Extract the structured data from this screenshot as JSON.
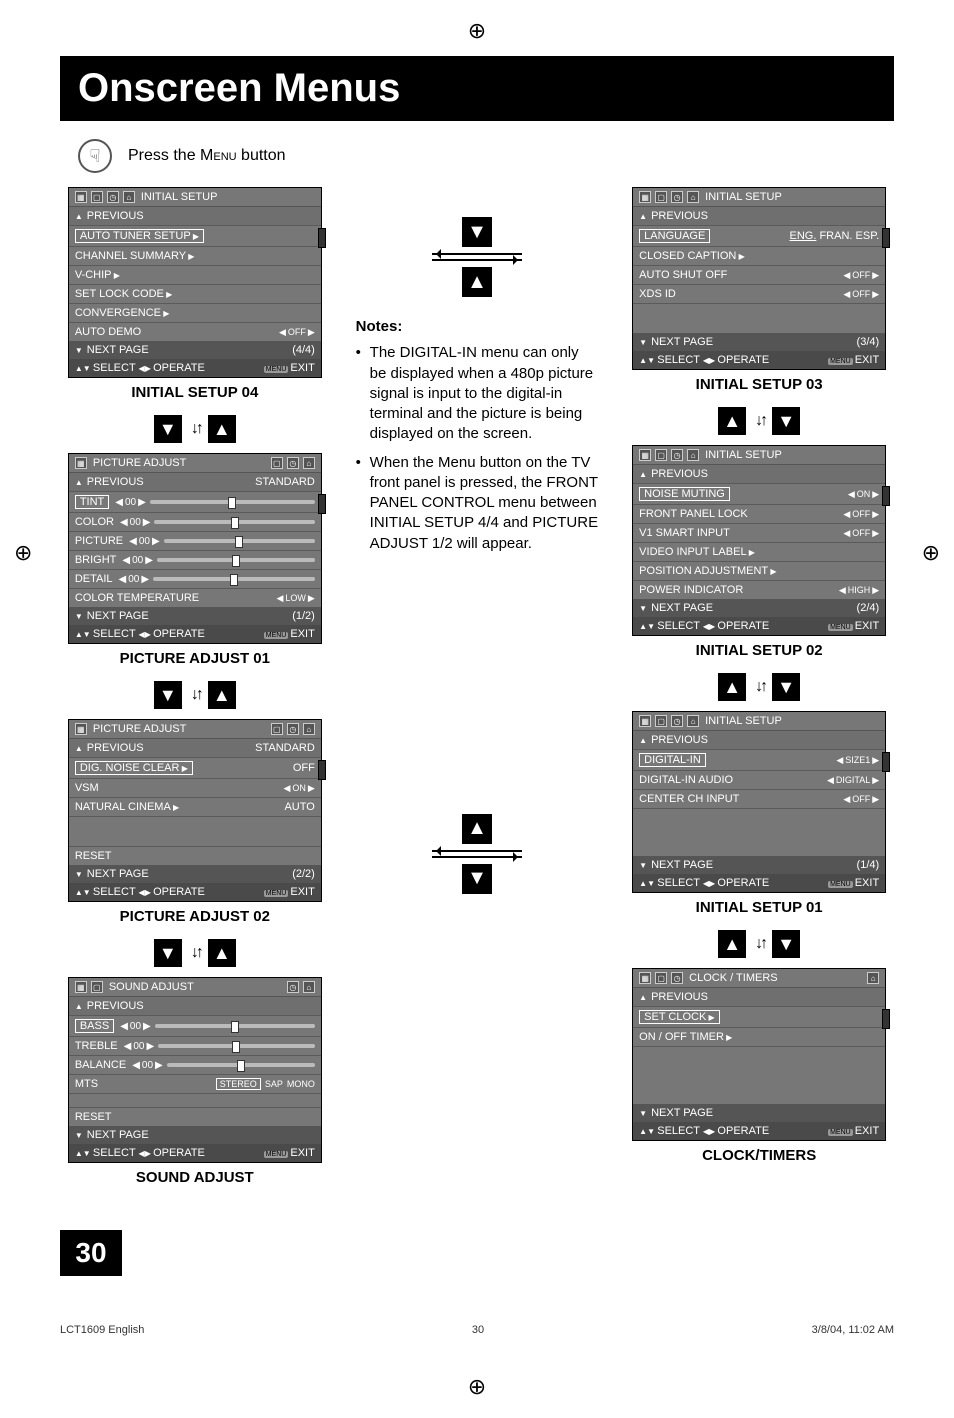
{
  "page": {
    "title": "Onscreen Menus",
    "instruction_pre": "Press the ",
    "instruction_menu": "Menu",
    "instruction_post": " button",
    "page_number": "30",
    "footer_left": "LCT1609 English",
    "footer_center": "30",
    "footer_right": "3/8/04, 11:02 AM"
  },
  "notes": {
    "heading": "Notes:",
    "items": [
      "The DIGITAL-IN menu can only be displayed when a 480p picture signal is input to the digital-in terminal and the picture is being displayed on the screen.",
      "When the Menu button on the TV front panel is pressed, the FRONT PANEL CONTROL menu between INITIAL SETUP 4/4 and PICTURE ADJUST 1/2 will appear."
    ]
  },
  "menus": {
    "is04": {
      "title": "INITIAL SETUP",
      "previous": "PREVIOUS",
      "rows": [
        {
          "label": "AUTO TUNER SETUP",
          "type": "arrow"
        },
        {
          "label": "CHANNEL SUMMARY",
          "type": "arrow"
        },
        {
          "label": "V-CHIP",
          "type": "arrow"
        },
        {
          "label": "SET LOCK CODE",
          "type": "arrow"
        },
        {
          "label": "CONVERGENCE",
          "type": "arrow"
        },
        {
          "label": "AUTO DEMO",
          "type": "lr",
          "value": "OFF"
        }
      ],
      "next": "NEXT PAGE",
      "next_v": "(4/4)",
      "foot_select": "SELECT",
      "foot_operate": "OPERATE",
      "foot_exit": "EXIT",
      "caption": "INITIAL SETUP 04"
    },
    "pa01": {
      "title": "PICTURE ADJUST",
      "previous": "PREVIOUS",
      "previous_right": "STANDARD",
      "rows": [
        {
          "label": "TINT",
          "type": "slider",
          "value": "00"
        },
        {
          "label": "COLOR",
          "type": "slider",
          "value": "00"
        },
        {
          "label": "PICTURE",
          "type": "slider",
          "value": "00"
        },
        {
          "label": "BRIGHT",
          "type": "slider",
          "value": "00"
        },
        {
          "label": "DETAIL",
          "type": "slider",
          "value": "00"
        },
        {
          "label": "COLOR TEMPERATURE",
          "type": "lr",
          "value": "LOW"
        }
      ],
      "next": "NEXT PAGE",
      "next_v": "(1/2)",
      "foot_select": "SELECT",
      "foot_operate": "OPERATE",
      "foot_exit": "EXIT",
      "caption": "PICTURE ADJUST 01"
    },
    "pa02": {
      "title": "PICTURE ADJUST",
      "previous": "PREVIOUS",
      "previous_right": "STANDARD",
      "rows": [
        {
          "label": "DIG. NOISE CLEAR",
          "type": "arrow",
          "value": "OFF"
        },
        {
          "label": "VSM",
          "type": "lr",
          "value": "ON"
        },
        {
          "label": "NATURAL CINEMA",
          "type": "arrow",
          "value": "AUTO"
        }
      ],
      "reset": "RESET",
      "next": "NEXT PAGE",
      "next_v": "(2/2)",
      "foot_select": "SELECT",
      "foot_operate": "OPERATE",
      "foot_exit": "EXIT",
      "caption": "PICTURE ADJUST 02"
    },
    "sa": {
      "title": "SOUND ADJUST",
      "previous": "PREVIOUS",
      "rows": [
        {
          "label": "BASS",
          "type": "slider",
          "value": "00"
        },
        {
          "label": "TREBLE",
          "type": "slider",
          "value": "00"
        },
        {
          "label": "BALANCE",
          "type": "slider",
          "value": "00"
        },
        {
          "label": "MTS",
          "type": "mts",
          "opts": [
            "STEREO",
            "SAP",
            "MONO"
          ]
        }
      ],
      "reset": "RESET",
      "next": "NEXT PAGE",
      "foot_select": "SELECT",
      "foot_operate": "OPERATE",
      "foot_exit": "EXIT",
      "caption": "SOUND ADJUST"
    },
    "is03": {
      "title": "INITIAL SETUP",
      "previous": "PREVIOUS",
      "rows": [
        {
          "label": "LANGUAGE",
          "type": "opts",
          "opts": [
            "ENG.",
            "FRAN.",
            "ESP."
          ]
        },
        {
          "label": "CLOSED CAPTION",
          "type": "arrow"
        },
        {
          "label": "AUTO SHUT OFF",
          "type": "lr",
          "value": "OFF"
        },
        {
          "label": "XDS ID",
          "type": "lr",
          "value": "OFF"
        }
      ],
      "next": "NEXT PAGE",
      "next_v": "(3/4)",
      "foot_select": "SELECT",
      "foot_operate": "OPERATE",
      "foot_exit": "EXIT",
      "caption": "INITIAL SETUP 03"
    },
    "is02": {
      "title": "INITIAL SETUP",
      "previous": "PREVIOUS",
      "rows": [
        {
          "label": "NOISE MUTING",
          "type": "lr",
          "value": "ON"
        },
        {
          "label": "FRONT PANEL LOCK",
          "type": "lr",
          "value": "OFF"
        },
        {
          "label": "V1 SMART INPUT",
          "type": "lr",
          "value": "OFF"
        },
        {
          "label": "VIDEO INPUT LABEL",
          "type": "arrow"
        },
        {
          "label": "POSITION ADJUSTMENT",
          "type": "arrow"
        },
        {
          "label": "POWER INDICATOR",
          "type": "lr",
          "value": "HIGH"
        }
      ],
      "next": "NEXT PAGE",
      "next_v": "(2/4)",
      "foot_select": "SELECT",
      "foot_operate": "OPERATE",
      "foot_exit": "EXIT",
      "caption": "INITIAL SETUP 02"
    },
    "is01": {
      "title": "INITIAL SETUP",
      "previous": "PREVIOUS",
      "rows": [
        {
          "label": "DIGITAL-IN",
          "type": "lr",
          "value": "SIZE1"
        },
        {
          "label": "DIGITAL-IN AUDIO",
          "type": "lr",
          "value": "DIGITAL"
        },
        {
          "label": "CENTER CH INPUT",
          "type": "lr",
          "value": "OFF"
        }
      ],
      "next": "NEXT PAGE",
      "next_v": "(1/4)",
      "foot_select": "SELECT",
      "foot_operate": "OPERATE",
      "foot_exit": "EXIT",
      "caption": "INITIAL SETUP 01"
    },
    "ct": {
      "title": "CLOCK / TIMERS",
      "previous": "PREVIOUS",
      "rows": [
        {
          "label": "SET CLOCK",
          "type": "arrow"
        },
        {
          "label": "ON / OFF TIMER",
          "type": "arrow"
        }
      ],
      "next": "NEXT PAGE",
      "foot_select": "SELECT",
      "foot_operate": "OPERATE",
      "foot_exit": "EXIT",
      "caption": "CLOCK/TIMERS"
    }
  }
}
